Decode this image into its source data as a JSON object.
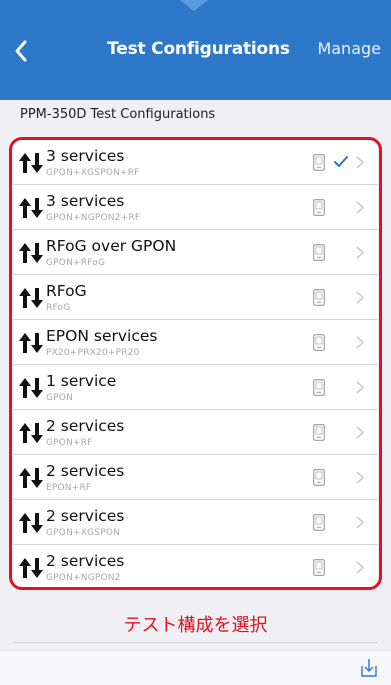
{
  "nav": {
    "title": "Test Configurations",
    "manage_label": "Manage",
    "back_icon": "chevron-left-icon",
    "accent_color": "#2d78c8"
  },
  "section": {
    "header": "PPM-350D Test Configurations"
  },
  "items": [
    {
      "title": "3 services",
      "subtitle": "GPON+XGSPON+RF",
      "selected": true
    },
    {
      "title": "3 services",
      "subtitle": "GPON+NGPON2+RF",
      "selected": false
    },
    {
      "title": "RFoG over GPON",
      "subtitle": "GPON+RFoG",
      "selected": false
    },
    {
      "title": "RFoG",
      "subtitle": "RFoG",
      "selected": false
    },
    {
      "title": "EPON services",
      "subtitle": "PX20+PRX20+PR20",
      "selected": false
    },
    {
      "title": "1 service",
      "subtitle": "GPON",
      "selected": false
    },
    {
      "title": "2 services",
      "subtitle": "GPON+RF",
      "selected": false
    },
    {
      "title": "2 services",
      "subtitle": "EPON+RF",
      "selected": false
    },
    {
      "title": "2 services",
      "subtitle": "GPON+XGSPON",
      "selected": false
    },
    {
      "title": "2 services",
      "subtitle": "GPON+NGPON2",
      "selected": false
    }
  ],
  "annotation": {
    "caption": "テスト構成を選択",
    "color": "#e3121f"
  },
  "toolbar": {
    "export_icon": "export-icon"
  }
}
